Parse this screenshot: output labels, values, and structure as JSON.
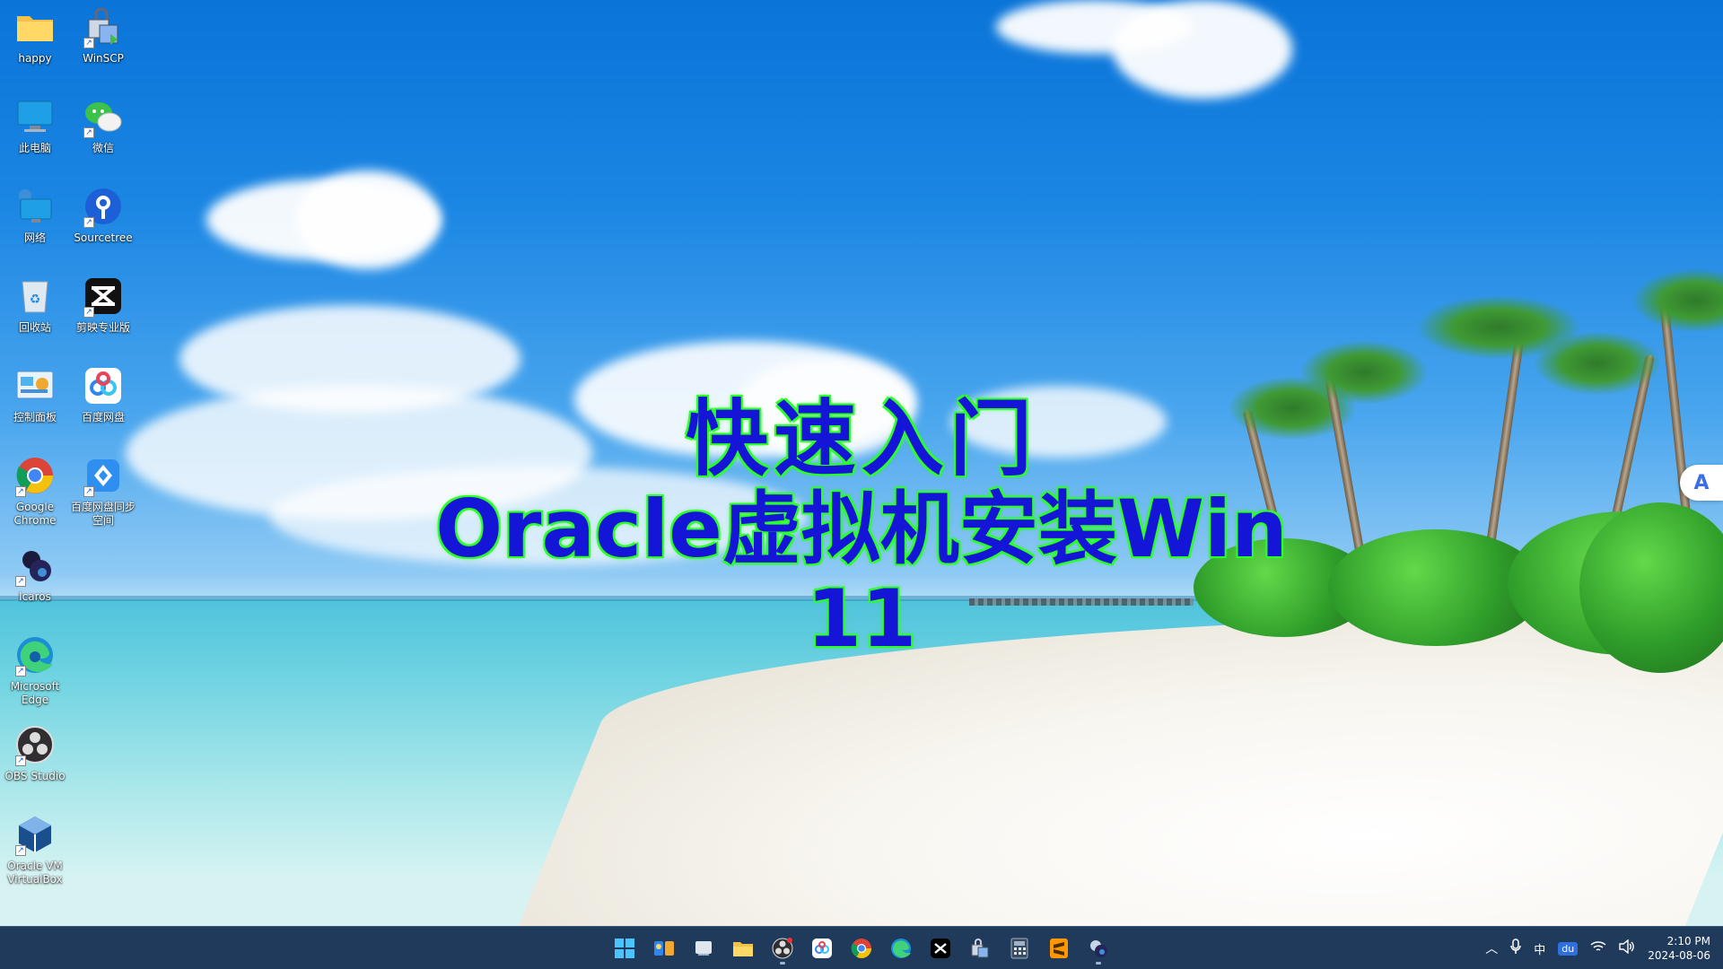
{
  "overlay": {
    "line1": "快速入门",
    "line2": "Oracle虚拟机安装Win 11"
  },
  "desktop_icons": [
    {
      "label": "happy",
      "icon": "folder-icon"
    },
    {
      "label": "WinSCP",
      "icon": "winscp-icon"
    },
    {
      "label": "此电脑",
      "icon": "this-pc-icon"
    },
    {
      "label": "微信",
      "icon": "wechat-icon"
    },
    {
      "label": "网络",
      "icon": "network-icon"
    },
    {
      "label": "Sourcetree",
      "icon": "sourcetree-icon"
    },
    {
      "label": "回收站",
      "icon": "recycle-bin-icon"
    },
    {
      "label": "剪映专业版",
      "icon": "capcut-icon"
    },
    {
      "label": "控制面板",
      "icon": "control-panel-icon"
    },
    {
      "label": "百度网盘",
      "icon": "baidu-netdisk-icon"
    },
    {
      "label": "Google Chrome",
      "icon": "chrome-icon"
    },
    {
      "label": "百度网盘同步空间",
      "icon": "baidu-sync-icon"
    },
    {
      "label": "Icaros",
      "icon": "icaros-icon"
    },
    {
      "label": "Microsoft Edge",
      "icon": "edge-icon"
    },
    {
      "label": "OBS Studio",
      "icon": "obs-icon"
    },
    {
      "label": "Oracle VM VirtualBox",
      "icon": "virtualbox-icon"
    }
  ],
  "side_assist": {
    "letter": "A"
  },
  "taskbar": {
    "apps": [
      "start-icon",
      "widgets-icon",
      "task-view-icon",
      "file-explorer-icon",
      "obs-icon",
      "baidu-netdisk-icon",
      "chrome-icon",
      "edge-icon",
      "capcut-icon",
      "winscp-icon",
      "calculator-icon",
      "sublime-icon",
      "icaros-icon"
    ],
    "tray": {
      "ime": "中",
      "baidu_ime": "du",
      "time": "2:10 PM",
      "date": "2024-08-06"
    }
  },
  "colors": {
    "overlay_text": "#1515d8",
    "overlay_glow": "#2cff28",
    "taskbar_bg": "#1f3a5a"
  }
}
